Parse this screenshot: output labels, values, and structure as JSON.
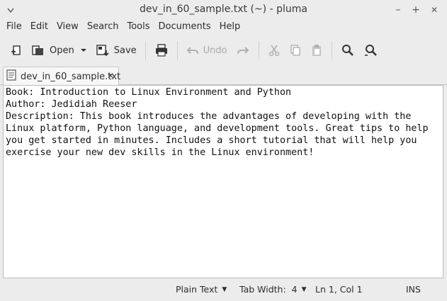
{
  "window": {
    "title": "dev_in_60_sample.txt (~) - pluma",
    "controls": {
      "minimize": "–",
      "maximize": "+",
      "close": "✕"
    }
  },
  "menubar": {
    "items": [
      "File",
      "Edit",
      "View",
      "Search",
      "Tools",
      "Documents",
      "Help"
    ]
  },
  "toolbar": {
    "new_icon": "new-document-icon",
    "open_label": "Open",
    "save_label": "Save",
    "print_icon": "print-icon",
    "undo_label": "Undo",
    "redo_icon": "redo-icon",
    "cut_icon": "cut-icon",
    "copy_icon": "copy-icon",
    "paste_icon": "paste-icon",
    "find_icon": "search-icon",
    "replace_icon": "search-replace-icon"
  },
  "tab": {
    "label": "dev_in_60_sample.txt",
    "close": "✕"
  },
  "document": {
    "lines": [
      "Book: Introduction to Linux Environment and Python",
      "Author: Jedidiah Reeser",
      "Description: This book introduces the advantages of developing with the",
      "Linux platform, Python language, and development tools. Great tips to help",
      "you get started in minutes. Includes a short tutorial that will help you",
      "exercise your new dev skills in the Linux environment!"
    ]
  },
  "statusbar": {
    "language": "Plain Text",
    "tab_width": "Tab Width:  4",
    "position": "Ln 1, Col 1",
    "mode": "INS"
  }
}
